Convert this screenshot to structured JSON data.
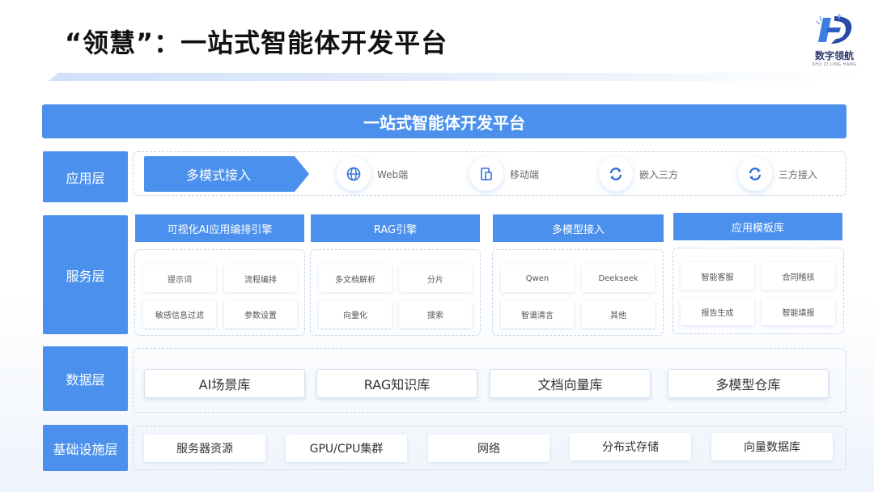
{
  "header": {
    "title": "“领慧”：一站式智能体开发平台",
    "logo_cn": "数字领航",
    "logo_en": "SHU ZI LING HANG"
  },
  "banner": "一站式智能体开发平台",
  "layers": {
    "app": {
      "label": "应用层",
      "primary": "多模式接入",
      "items": [
        {
          "label": "Web端",
          "icon": "globe-icon"
        },
        {
          "label": "移动端",
          "icon": "mobile-icon"
        },
        {
          "label": "嵌入三方",
          "icon": "sync-icon"
        },
        {
          "label": "三方接入",
          "icon": "sync-icon"
        }
      ]
    },
    "service": {
      "label": "服务层",
      "modules": [
        {
          "title": "可视化AI应用编排引擎",
          "items": [
            "提示词",
            "流程编排",
            "敏感信息过滤",
            "参数设置"
          ]
        },
        {
          "title": "RAG引擎",
          "items": [
            "多文档解析",
            "分片",
            "向量化",
            "搜索"
          ]
        },
        {
          "title": "多模型接入",
          "items": [
            "Qwen",
            "Deekseek",
            "智谱清言",
            "其他"
          ]
        },
        {
          "title": "应用模板库",
          "items": [
            "智能客服",
            "合同稽核",
            "报告生成",
            "智能填报"
          ]
        }
      ]
    },
    "data": {
      "label": "数据层",
      "items": [
        "AI场景库",
        "RAG知识库",
        "文档向量库",
        "多模型仓库"
      ]
    },
    "infra": {
      "label": "基础设施层",
      "items": [
        "服务器资源",
        "GPU/CPU集群",
        "网络",
        "分布式存储",
        "向量数据库"
      ]
    }
  },
  "colors": {
    "accent": "#4a90ec",
    "dashed_border": "#c7d3e6"
  }
}
